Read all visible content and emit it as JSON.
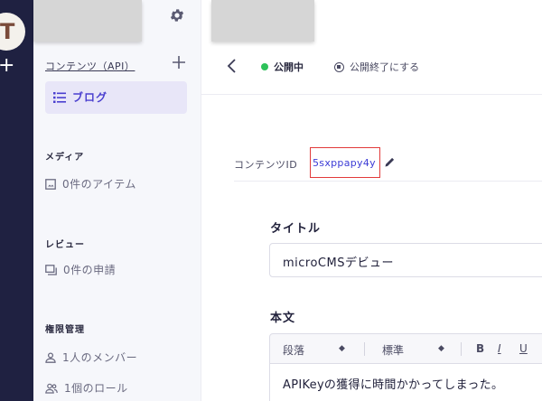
{
  "rail": {
    "avatar_initial": "T"
  },
  "sidebar": {
    "api_link": "コンテンツ（API）",
    "active_item": "ブログ",
    "sections": [
      {
        "heading": "メディア",
        "item": "0件のアイテム"
      },
      {
        "heading": "レビュー",
        "item": "0件の申請"
      },
      {
        "heading": "権限管理",
        "items": [
          "1人のメンバー",
          "1個のロール"
        ]
      }
    ]
  },
  "header": {
    "status": "公開中",
    "unpublish": "公開終了にする"
  },
  "content_id": {
    "label": "コンテンツID",
    "value": "5sxppapy4y"
  },
  "fields": {
    "title_label": "タイトル",
    "title_value": "microCMSデビュー",
    "body_label": "本文",
    "toolbar": {
      "paragraph": "段落",
      "size": "標準",
      "bold": "B",
      "italic": "I",
      "underline": "U"
    },
    "body_value": "APIKeyの獲得に時間かかってしまった。"
  },
  "colors": {
    "rail": "#1f2141",
    "accent": "#4a3fcf",
    "published": "#2ec25a",
    "highlight_border": "#e23a3a",
    "id_text": "#3b3bd6"
  }
}
